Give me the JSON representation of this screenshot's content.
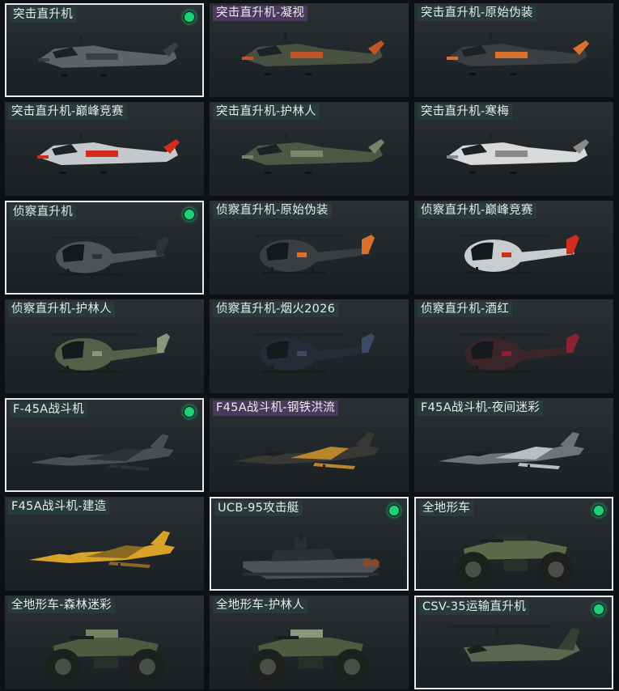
{
  "colors": {
    "accent": "#1fd27a",
    "border": "#e9ecec"
  },
  "tiles": [
    {
      "label": "突击直升机",
      "equipped": true,
      "kind": "apache",
      "color": "#5d6468",
      "accent": "#3a3f42"
    },
    {
      "label": "突击直升机-凝视",
      "equipped": false,
      "kind": "apache",
      "color": "#4a5040",
      "accent": "#c0542a",
      "tag": "purple"
    },
    {
      "label": "突击直升机-原始伪装",
      "equipped": false,
      "kind": "apache",
      "color": "#3b3f42",
      "accent": "#d8702e"
    },
    {
      "label": "突击直升机-巅峰竞赛",
      "equipped": false,
      "kind": "apache",
      "color": "#c5c9cb",
      "accent": "#d22c1c"
    },
    {
      "label": "突击直升机-护林人",
      "equipped": false,
      "kind": "apache",
      "color": "#4e5644",
      "accent": "#7b8466"
    },
    {
      "label": "突击直升机-寒梅",
      "equipped": false,
      "kind": "apache",
      "color": "#d8d9d8",
      "accent": "#8a8a8a"
    },
    {
      "label": "侦察直升机",
      "equipped": true,
      "kind": "scout",
      "color": "#4e5356",
      "accent": "#2f3335"
    },
    {
      "label": "侦察直升机-原始伪装",
      "equipped": false,
      "kind": "scout",
      "color": "#3b3e40",
      "accent": "#d8702e"
    },
    {
      "label": "侦察直升机-巅峰竞赛",
      "equipped": false,
      "kind": "scout",
      "color": "#c9cdcf",
      "accent": "#d22c1c"
    },
    {
      "label": "侦察直升机-护林人",
      "equipped": false,
      "kind": "scout",
      "color": "#556049",
      "accent": "#8d957a"
    },
    {
      "label": "侦察直升机-烟火2026",
      "equipped": false,
      "kind": "scout",
      "color": "#262c36",
      "accent": "#3d4a66"
    },
    {
      "label": "侦察直升机-酒红",
      "equipped": false,
      "kind": "scout",
      "color": "#3a2528",
      "accent": "#8a2230"
    },
    {
      "label": "F-45A战斗机",
      "equipped": true,
      "kind": "jet",
      "color": "#4a4f53",
      "accent": "#2e3235"
    },
    {
      "label": "F45A战斗机-钢铁洪流",
      "equipped": false,
      "kind": "jet",
      "color": "#3a3835",
      "accent": "#b8862e",
      "tag": "purple"
    },
    {
      "label": "F45A战斗机-夜间迷彩",
      "equipped": false,
      "kind": "jet",
      "color": "#6d747a",
      "accent": "#b8bec2"
    },
    {
      "label": "F45A战斗机-建造",
      "equipped": false,
      "kind": "jet",
      "color": "#d8a22a",
      "accent": "#8a6a20"
    },
    {
      "label": "UCB-95攻击艇",
      "equipped": true,
      "kind": "boat",
      "color": "#4d5256",
      "accent": "#2d3134"
    },
    {
      "label": "全地形车",
      "equipped": true,
      "kind": "atv",
      "color": "#5b6a48",
      "accent": "#2b2e2a"
    },
    {
      "label": "全地形车-森林迷彩",
      "equipped": false,
      "kind": "atv",
      "color": "#4f5a3e",
      "accent": "#7a8060"
    },
    {
      "label": "全地形车-护林人",
      "equipped": false,
      "kind": "atv",
      "color": "#4f5a3e",
      "accent": "#8d957a"
    },
    {
      "label": "CSV-35运输直升机",
      "equipped": true,
      "kind": "osprey",
      "color": "#5d6650",
      "accent": "#3a3f33"
    }
  ]
}
